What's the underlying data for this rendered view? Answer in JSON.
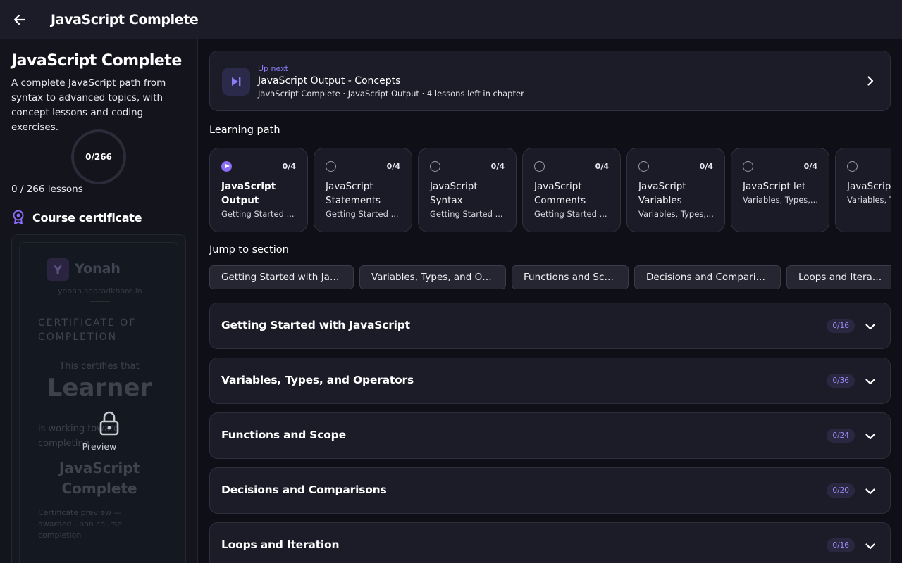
{
  "appbar": {
    "title": "JavaScript Complete"
  },
  "sidebar": {
    "course_title": "JavaScript Complete",
    "description": "A complete JavaScript path from syntax to advanced topics, with concept lessons and coding exercises.",
    "progress_label": "0/266",
    "progress_fraction": 0,
    "lessons_label": "0 / 266 lessons",
    "certificate_heading": "Course certificate",
    "certificate": {
      "logo_letter": "Y",
      "brand": "Yonah",
      "site": "yonah.sharadkhare.in",
      "heading": "CERTIFICATE OF COMPLETION",
      "certifies": "This certifies that",
      "learner": "Learner",
      "working": "is working toward completing",
      "course": "JavaScript Complete",
      "note": "Certificate preview — awarded upon course completion",
      "preview_label": "Preview"
    }
  },
  "upnext": {
    "kicker": "Up next",
    "title": "JavaScript Output - Concepts",
    "subtitle": "JavaScript Complete · JavaScript Output · 4 lessons left in chapter"
  },
  "learning_path": {
    "label": "Learning path",
    "cards": [
      {
        "title": "JavaScript Output",
        "subtitle": "Getting Started ...",
        "count": "0/4",
        "active": true
      },
      {
        "title": "JavaScript Statements",
        "subtitle": "Getting Started ...",
        "count": "0/4",
        "active": false
      },
      {
        "title": "JavaScript Syntax",
        "subtitle": "Getting Started ...",
        "count": "0/4",
        "active": false
      },
      {
        "title": "JavaScript Comments",
        "subtitle": "Getting Started ...",
        "count": "0/4",
        "active": false
      },
      {
        "title": "JavaScript Variables",
        "subtitle": "Variables, Types,...",
        "count": "0/4",
        "active": false
      },
      {
        "title": "JavaScript let",
        "subtitle": "Variables, Types,...",
        "count": "0/4",
        "active": false
      },
      {
        "title": "JavaScript",
        "subtitle": "Variables, T",
        "count": "",
        "active": false
      }
    ]
  },
  "jump": {
    "label": "Jump to section",
    "chips": [
      "Getting Started with Java...",
      "Variables, Types, and Ope...",
      "Functions and Scope",
      "Decisions and Comparisons",
      "Loops and Iteration"
    ]
  },
  "sections": [
    {
      "title": "Getting Started with JavaScript",
      "badge": "0/16"
    },
    {
      "title": "Variables, Types, and Operators",
      "badge": "0/36"
    },
    {
      "title": "Functions and Scope",
      "badge": "0/24"
    },
    {
      "title": "Decisions and Comparisons",
      "badge": "0/20"
    },
    {
      "title": "Loops and Iteration",
      "badge": "0/16"
    }
  ],
  "colors": {
    "accent": "#8b6cf6",
    "background": "#0f0f17",
    "surface": "#1c1c28"
  }
}
